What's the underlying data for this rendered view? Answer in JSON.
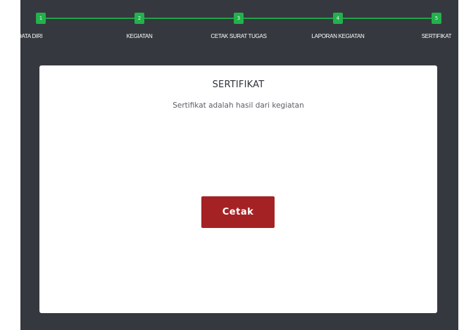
{
  "stepper": {
    "steps": [
      {
        "number": "1",
        "label": "DATA DIRI"
      },
      {
        "number": "2",
        "label": "KEGIATAN"
      },
      {
        "number": "3",
        "label": "CETAK SURAT TUGAS"
      },
      {
        "number": "4",
        "label": "LAPORAN KEGIATAN"
      },
      {
        "number": "5",
        "label": "SERTIFIKAT"
      }
    ],
    "active_step": 5,
    "progress": 1.0
  },
  "card": {
    "title": "SERTIFIKAT",
    "subtitle": "Sertifikat adalah hasil dari kegiatan",
    "print_button_label": "Cetak"
  },
  "colors": {
    "background": "#35383e",
    "step_green": "#22b14c",
    "button_red": "#a52224",
    "card": "#ffffff"
  }
}
